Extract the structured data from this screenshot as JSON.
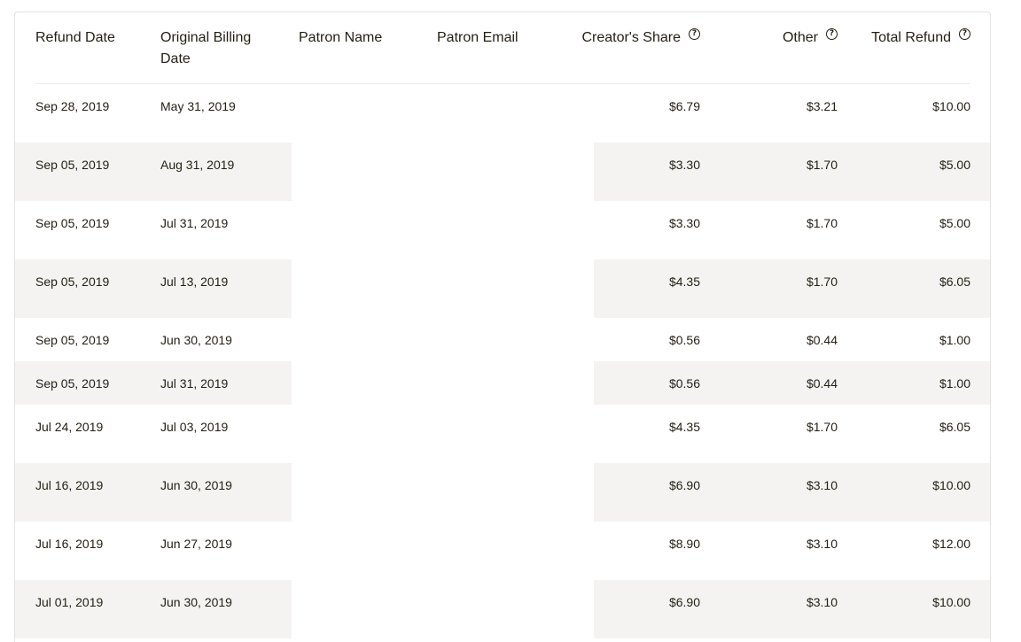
{
  "table": {
    "columns": {
      "refund_date": "Refund Date",
      "original_billing_date_line1": "Original Billing",
      "original_billing_date_line2": "Date",
      "patron_name": "Patron Name",
      "patron_email": "Patron Email",
      "creators_share": "Creator's Share",
      "other": "Other",
      "total_refund": "Total Refund"
    },
    "help_icon_glyph": "?",
    "rows": [
      {
        "refund_date": "Sep 28, 2019",
        "billing_date": "May 31, 2019",
        "patron_name": "",
        "patron_email": "",
        "creators_share": "$6.79",
        "other": "$3.21",
        "total": "$10.00"
      },
      {
        "refund_date": "Sep 05, 2019",
        "billing_date": "Aug 31, 2019",
        "patron_name": "",
        "patron_email": "",
        "creators_share": "$3.30",
        "other": "$1.70",
        "total": "$5.00"
      },
      {
        "refund_date": "Sep 05, 2019",
        "billing_date": "Jul 31, 2019",
        "patron_name": "",
        "patron_email": "",
        "creators_share": "$3.30",
        "other": "$1.70",
        "total": "$5.00"
      },
      {
        "refund_date": "Sep 05, 2019",
        "billing_date": "Jul 13, 2019",
        "patron_name": "",
        "patron_email": "",
        "creators_share": "$4.35",
        "other": "$1.70",
        "total": "$6.05"
      },
      {
        "refund_date": "Sep 05, 2019",
        "billing_date": "Jun 30, 2019",
        "patron_name": "",
        "patron_email": "",
        "creators_share": "$0.56",
        "other": "$0.44",
        "total": "$1.00"
      },
      {
        "refund_date": "Sep 05, 2019",
        "billing_date": "Jul 31, 2019",
        "patron_name": "",
        "patron_email": "",
        "creators_share": "$0.56",
        "other": "$0.44",
        "total": "$1.00"
      },
      {
        "refund_date": "Jul 24, 2019",
        "billing_date": "Jul 03, 2019",
        "patron_name": "",
        "patron_email": "",
        "creators_share": "$4.35",
        "other": "$1.70",
        "total": "$6.05"
      },
      {
        "refund_date": "Jul 16, 2019",
        "billing_date": "Jun 30, 2019",
        "patron_name": "",
        "patron_email": "",
        "creators_share": "$6.90",
        "other": "$3.10",
        "total": "$10.00"
      },
      {
        "refund_date": "Jul 16, 2019",
        "billing_date": "Jun 27, 2019",
        "patron_name": "",
        "patron_email": "",
        "creators_share": "$8.90",
        "other": "$3.10",
        "total": "$12.00"
      },
      {
        "refund_date": "Jul 01, 2019",
        "billing_date": "Jun 30, 2019",
        "patron_name": "",
        "patron_email": "",
        "creators_share": "$6.90",
        "other": "$3.10",
        "total": "$10.00"
      }
    ]
  },
  "colors": {
    "text": "#241e12",
    "row_shade": "#f4f3f1",
    "border": "#e5e3dd"
  }
}
